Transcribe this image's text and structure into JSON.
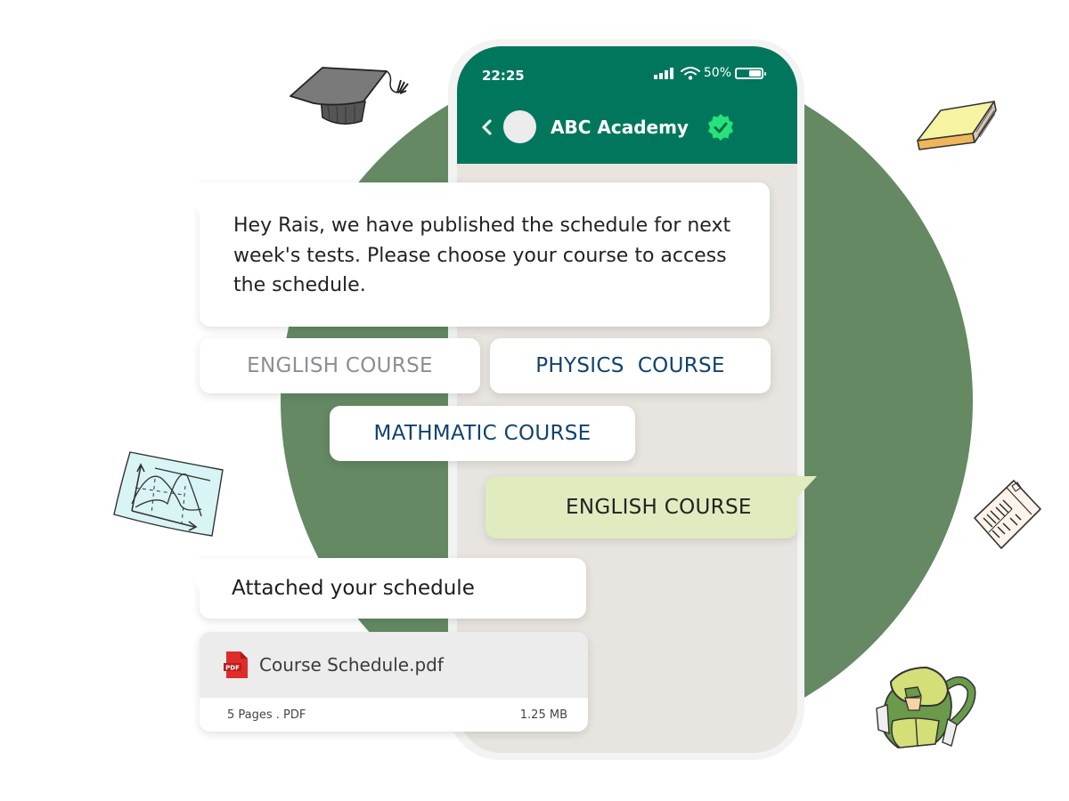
{
  "status_bar": {
    "time": "22:25",
    "battery_percent": "50%",
    "battery_level": 0.5,
    "signal_icon": "signal-bars-icon",
    "wifi_icon": "wifi-icon",
    "battery_icon": "battery-icon"
  },
  "chat_header": {
    "title": "ABC Academy",
    "back_icon": "chevron-left-icon",
    "verified_icon": "verified-badge-icon"
  },
  "messages": {
    "incoming_1": "Hey Rais, we have published the schedule for next week's tests. Please choose your course to access the schedule.",
    "options": [
      {
        "label": "ENGLISH COURSE",
        "state": "selected"
      },
      {
        "label": "PHYSICS  COURSE",
        "state": "default"
      },
      {
        "label": "MATHMATIC COURSE",
        "state": "default"
      }
    ],
    "outgoing_reply": "ENGLISH COURSE",
    "incoming_2": "Attached your schedule",
    "attachment": {
      "file_name": "Course Schedule.pdf",
      "meta": "5 Pages . PDF",
      "size": "1.25 MB",
      "icon": "pdf-file-icon",
      "icon_label": "PDF"
    }
  },
  "colors": {
    "header_green": "#00775c",
    "background_circle": "#648963",
    "reply_bubble": "#e0ebbf",
    "option_text": "#11426e",
    "option_text_muted": "#8a8f94",
    "verified_badge": "#25e37a",
    "pdf_red": "#e02b2b"
  },
  "decorations": [
    "graduation-cap-icon",
    "book-icon",
    "graph-paper-icon",
    "document-icon",
    "backpack-icon"
  ]
}
